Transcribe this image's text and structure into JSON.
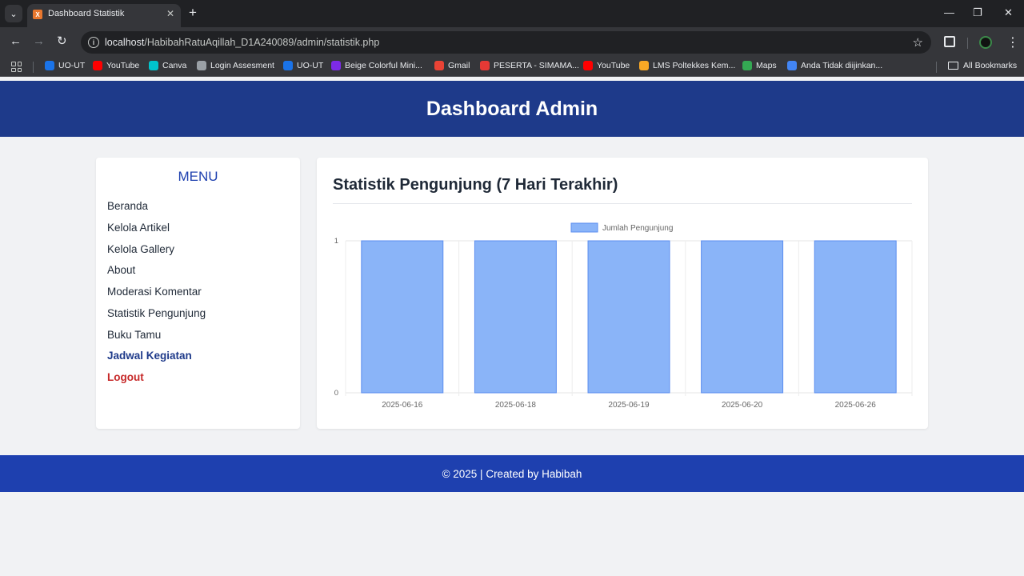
{
  "browser": {
    "tab_title": "Dashboard Statistik",
    "tab_favicon_letter": "X",
    "url_host": "localhost",
    "url_path": "/HabibahRatuAqillah_D1A240089/admin/statistik.php",
    "bookmarks": [
      {
        "label": "UO-UT",
        "icon": "uo-ut-icon",
        "color": "#1a73e8"
      },
      {
        "label": "YouTube",
        "icon": "youtube-icon",
        "color": "#ff0000"
      },
      {
        "label": "Canva",
        "icon": "canva-icon",
        "color": "#00c4cc"
      },
      {
        "label": "Login Assesment",
        "icon": "globe-icon",
        "color": "#9aa0a6"
      },
      {
        "label": "UO-UT",
        "icon": "uo-ut-icon",
        "color": "#1a73e8"
      },
      {
        "label": "Beige Colorful Mini...",
        "icon": "canva-icon",
        "color": "#7d2ae8"
      },
      {
        "label": "Gmail",
        "icon": "gmail-icon",
        "color": "#ea4335"
      },
      {
        "label": "PESERTA - SIMAMA...",
        "icon": "simama-icon",
        "color": "#e53935"
      },
      {
        "label": "YouTube",
        "icon": "youtube-icon",
        "color": "#ff0000"
      },
      {
        "label": "LMS Poltekkes Kem...",
        "icon": "lms-icon",
        "color": "#f9a825"
      },
      {
        "label": "Maps",
        "icon": "maps-icon",
        "color": "#34a853"
      },
      {
        "label": "Anda Tidak diijinkan...",
        "icon": "site-icon",
        "color": "#4285f4"
      }
    ],
    "all_bookmarks": "All Bookmarks"
  },
  "header": {
    "title": "Dashboard Admin"
  },
  "sidebar": {
    "title": "MENU",
    "items": [
      {
        "label": "Beranda",
        "state": "normal"
      },
      {
        "label": "Kelola Artikel",
        "state": "normal"
      },
      {
        "label": "Kelola Gallery",
        "state": "normal"
      },
      {
        "label": "About",
        "state": "normal"
      },
      {
        "label": "Moderasi Komentar",
        "state": "normal"
      },
      {
        "label": "Statistik Pengunjung",
        "state": "normal"
      },
      {
        "label": "Buku Tamu",
        "state": "normal"
      },
      {
        "label": "Jadwal Kegiatan",
        "state": "active"
      },
      {
        "label": "Logout",
        "state": "logout"
      }
    ]
  },
  "main": {
    "title": "Statistik Pengunjung (7 Hari Terakhir)"
  },
  "chart_data": {
    "type": "bar",
    "categories": [
      "2025-06-16",
      "2025-06-18",
      "2025-06-19",
      "2025-06-20",
      "2025-06-26"
    ],
    "series": [
      {
        "name": "Jumlah Pengunjung",
        "values": [
          1,
          1,
          1,
          1,
          1
        ]
      }
    ],
    "ylim": [
      0,
      1
    ],
    "yticks": [
      "0",
      "1"
    ],
    "grid": true,
    "legend_position": "top-center",
    "bar_color": "#8ab4f8",
    "bar_border_color": "#5b8def"
  },
  "footer": {
    "text": "© 2025 | Created by Habibah"
  },
  "colors": {
    "header_bg": "#1e3a8a",
    "footer_bg": "#1e40af",
    "accent": "#1e40af",
    "logout": "#c62828"
  }
}
